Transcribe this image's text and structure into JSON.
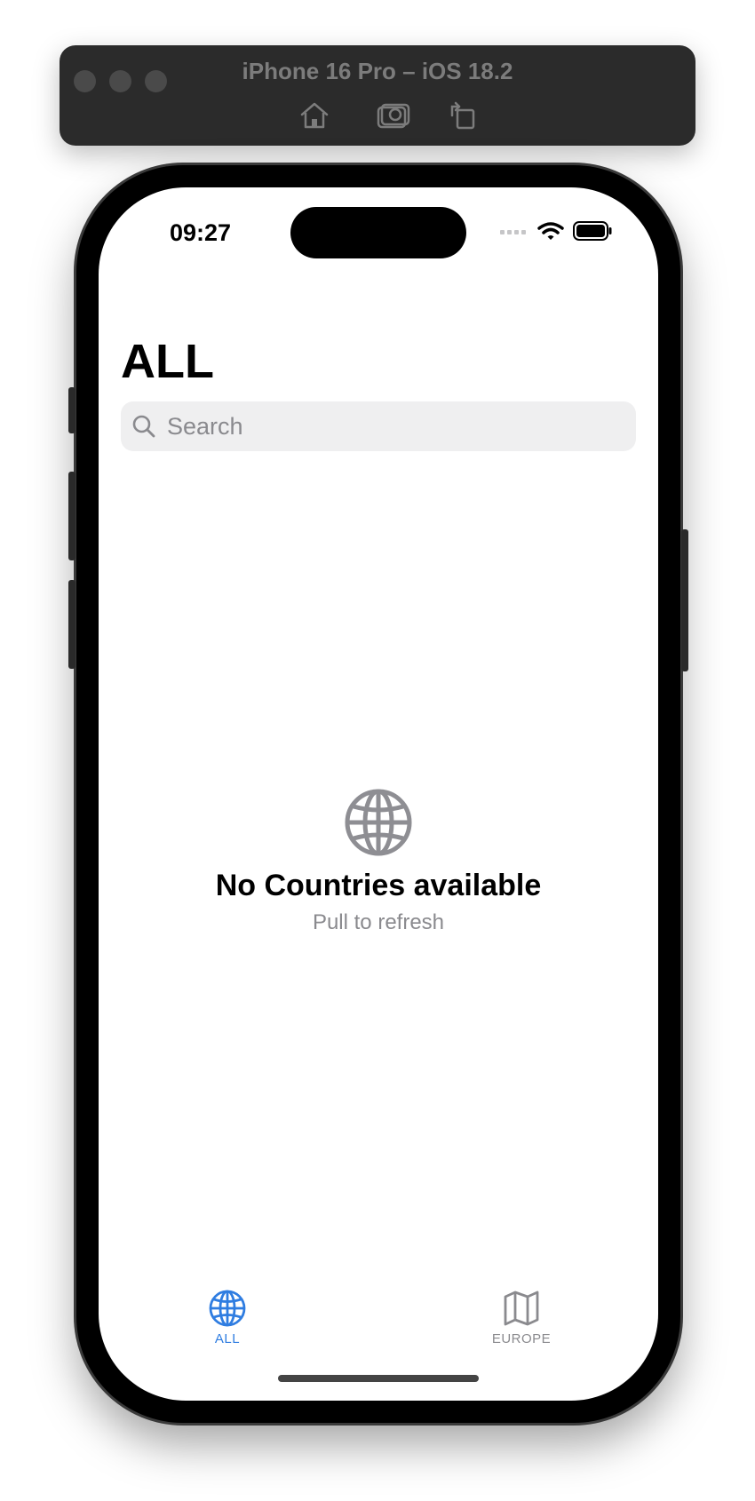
{
  "simulator": {
    "title": "iPhone 16 Pro – iOS 18.2",
    "buttons": [
      "home-icon",
      "screenshot-icon",
      "rotate-icon"
    ]
  },
  "status_bar": {
    "time": "09:27",
    "icons": [
      "cellular-icon",
      "wifi-icon",
      "battery-icon"
    ]
  },
  "nav": {
    "title": "ALL"
  },
  "search": {
    "placeholder": "Search",
    "value": ""
  },
  "empty_state": {
    "icon": "globe-icon",
    "title": "No Countries available",
    "subtitle": "Pull to refresh"
  },
  "tabs": [
    {
      "label": "ALL",
      "icon": "globe-icon",
      "selected": true
    },
    {
      "label": "EUROPE",
      "icon": "map-icon",
      "selected": false
    }
  ],
  "colors": {
    "accent": "#2f7de1",
    "inactive": "#8a8a8e",
    "search_bg": "#efeff0"
  }
}
